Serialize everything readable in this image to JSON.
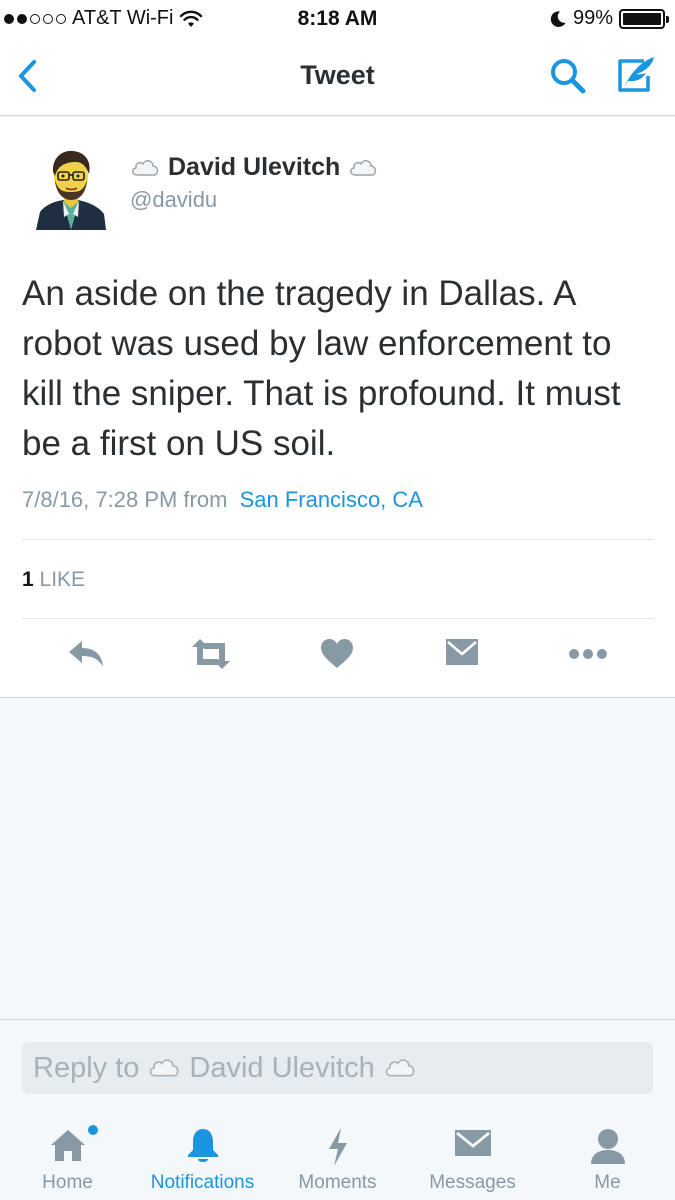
{
  "status_bar": {
    "carrier": "AT&T Wi-Fi",
    "time": "8:18 AM",
    "battery": "99%",
    "battery_level": 0.99,
    "signal_bars_filled": 2,
    "signal_bars_total": 5,
    "icons": [
      "wifi-icon",
      "moon-icon",
      "battery-icon"
    ]
  },
  "nav": {
    "title": "Tweet",
    "icons": [
      "back-chevron-icon",
      "search-icon",
      "compose-icon"
    ]
  },
  "tweet": {
    "author_name": "David Ulevitch",
    "handle": "@davidu",
    "name_emoji": "cloud-icon",
    "text": "An aside on the tragedy in Dallas. A robot was used by law enforcement to kill the sniper. That is profound. It must be a first on US soil.",
    "timestamp": "7/8/16, 7:28 PM from",
    "location": "San Francisco, CA",
    "likes_count": "1",
    "likes_label": "LIKE",
    "actions": [
      "reply-icon",
      "retweet-icon",
      "like-icon",
      "direct-message-icon",
      "more-icon"
    ]
  },
  "reply": {
    "prefix": "Reply to",
    "name": "David Ulevitch"
  },
  "tabs": [
    {
      "label": "Home",
      "icon": "home-icon",
      "unread": true
    },
    {
      "label": "Notifications",
      "icon": "bell-icon",
      "active": true
    },
    {
      "label": "Moments",
      "icon": "lightning-icon"
    },
    {
      "label": "Messages",
      "icon": "envelope-icon"
    },
    {
      "label": "Me",
      "icon": "person-icon"
    }
  ],
  "colors": {
    "accent": "#1b95e0",
    "icon_gray": "#8899a6",
    "text": "#292f33",
    "background": "#f5f8fa"
  }
}
